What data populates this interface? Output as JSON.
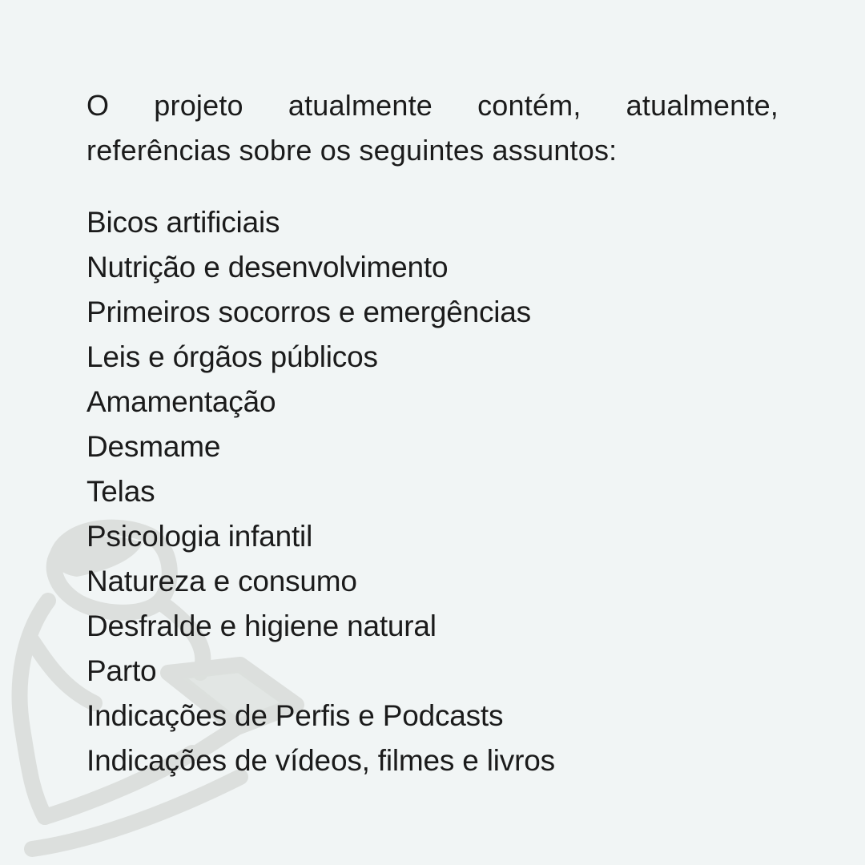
{
  "intro": "O projeto atualmente contém, atualmente, referências sobre os seguintes assuntos:",
  "topics": [
    "Bicos artificiais",
    "Nutrição e desenvolvimento",
    "Primeiros socorros e emergências",
    "Leis e órgãos públicos",
    "Amamentação",
    "Desmame",
    "Telas",
    "Psicologia infantil",
    "Natureza e consumo",
    "Desfralde e higiene natural",
    "Parto",
    "Indicações de Perfis e Podcasts",
    "Indicações de vídeos, filmes e livros"
  ],
  "colors": {
    "background": "#f1f5f5",
    "text": "#1b1b1b",
    "watermark": "#dcdfdd"
  }
}
